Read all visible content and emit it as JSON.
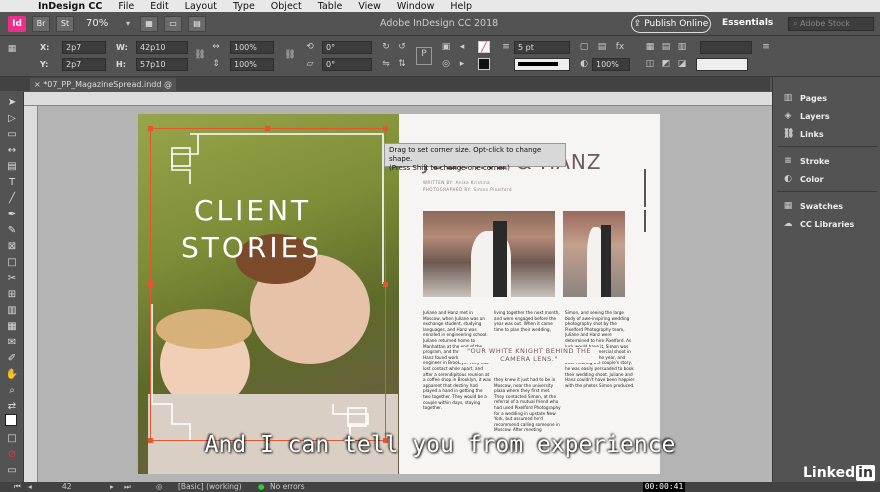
{
  "menubar": {
    "app": "InDesign CC",
    "items": [
      "File",
      "Edit",
      "Layout",
      "Type",
      "Object",
      "Table",
      "View",
      "Window",
      "Help"
    ]
  },
  "appbar": {
    "logo": "Id",
    "btn1": "Br",
    "btn2": "St",
    "zoom": "70%",
    "title": "Adobe InDesign CC 2018",
    "publish": "Publish Online",
    "workspace": "Essentials",
    "search_placeholder": "Adobe Stock"
  },
  "control": {
    "x_label": "X:",
    "x_value": "2p7",
    "y_label": "Y:",
    "y_value": "2p7",
    "w_label": "W:",
    "w_value": "42p10",
    "h_label": "H:",
    "h_value": "57p10",
    "scale_x": "100%",
    "scale_y": "100%",
    "rotate": "0°",
    "shear": "0°",
    "stroke_weight": "5 pt",
    "opacity": "100%"
  },
  "document_tab": "*07_PP_MagazineSpread.indd @ 70%",
  "tooltip": {
    "line1": "Drag to set corner size. Opt-click to change shape.",
    "line2": "(Press Shift to change one corner.)"
  },
  "spread": {
    "left_title_line1": "CLIENT",
    "left_title_line2": "STORIES",
    "right_title": "JULIANE & HANZ",
    "byline1": "WRITTEN BY: Anika Kristina",
    "byline2": "PHOTOGRAPHED BY: Simon Pixelford",
    "col1": "Juliane and Hanz met in Moscow, when Juliane was an exchange student, studying languages, and Hanz was enrolled in engineering school. Juliane returned home to Manhattan at the end of the program, and three years later, Hanz found work as a civil engineer in Brooklyn. They had lost contact while apart, and after a serendipitous reunion at a coffee shop in Brooklyn, it was apparent that destiny had played a hand in getting the two together. They would be a couple within days, staying together.",
    "col2a": "living together the next month, and were engaged before the year was out. When it came time to plan their wedding,",
    "col2b": "they knew it just had to be in Moscow, near the university plaza where they first met. They contacted Simon, at the referral of a mutual friend who had used Pixelford Photography for a wedding in upstate New York, but assumed he'd recommend calling someone in Moscow. After meeting",
    "col3": "Simon, and seeing the large body of awe-inspiring wedding photography shot by the Pixelford Photography team, Juliane and Hanz were determined to hire Pixelford. As luck would have it, Simon was shooting a commercial shoot in Europe later in the year, and after hearing the couple's story, he was easily persuaded to book their wedding shoot. Juliane and Hanz couldn't have been happier with the photos Simon produced.",
    "pullquote": "\"OUR WHITE KNIGHT BEHIND THE CAMERA LENS.\""
  },
  "panels": [
    "Pages",
    "Layers",
    "Links",
    "Stroke",
    "Color",
    "Swatches",
    "CC Libraries"
  ],
  "status": {
    "page": "42",
    "style": "[Basic] (working)",
    "errors": "No errors"
  },
  "caption": "And I can tell you from experience",
  "timestamp": "00:00:41",
  "brand": {
    "linked": "Linked",
    "in": "in"
  },
  "colors": {
    "accent": "#e4572e",
    "pink": "#ec2f8c",
    "title_mauve": "#6d5a62"
  }
}
